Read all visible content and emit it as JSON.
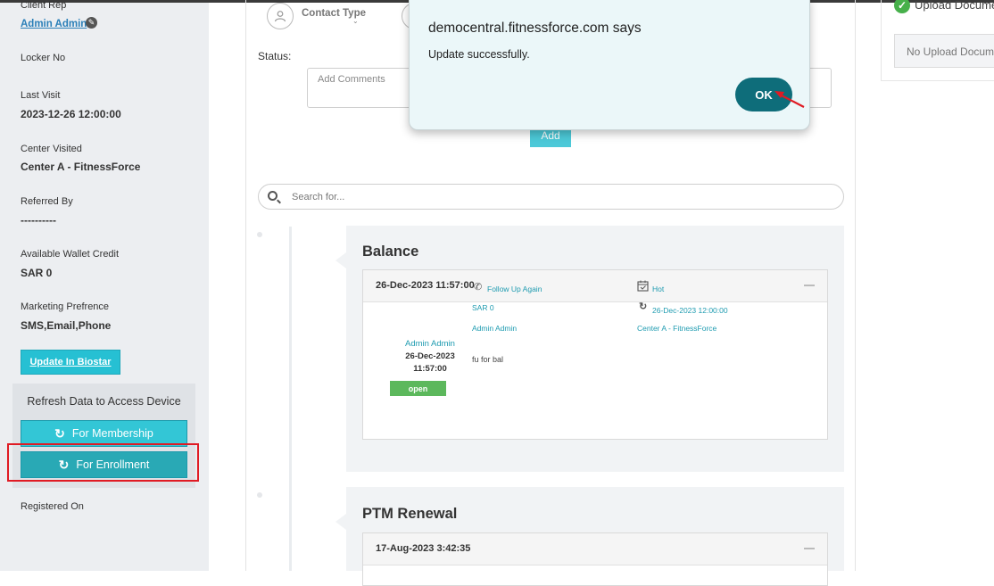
{
  "sidebar": {
    "client_rep_label": "Client Rep",
    "client_rep_value": "Admin Admin",
    "locker_label": "Locker No",
    "last_visit_label": "Last Visit",
    "last_visit_value": "2023-12-26 12:00:00",
    "center_visited_label": "Center Visited",
    "center_visited_value": "Center A - FitnessForce",
    "referred_by_label": "Referred By",
    "referred_by_value": "----------",
    "wallet_label": "Available Wallet Credit",
    "wallet_value": "SAR 0",
    "marketing_label": "Marketing Prefrence",
    "marketing_value": "SMS,Email,Phone",
    "biostar_button": "Update In Biostar",
    "refresh_title": "Refresh Data to Access Device",
    "membership_button": "For Membership",
    "enrollment_button": "For Enrollment",
    "registered_on_label": "Registered On"
  },
  "form": {
    "contact_type_label": "Contact Type",
    "status_label": "Status:",
    "comments_placeholder": "Add Comments",
    "add_button": "Add",
    "search_placeholder": "Search for..."
  },
  "cards": [
    {
      "title": "Balance",
      "entry_date": "26-Dec-2023 11:57:00",
      "user": "Admin Admin",
      "user_date": "26-Dec-2023",
      "user_time": "11:57:00",
      "status_badge": "open",
      "follow_up": "Follow Up Again",
      "priority": "Hot",
      "amount": "SAR 0",
      "next_date": "26-Dec-2023 12:00:00",
      "assigned_to": "Admin Admin",
      "center": "Center A - FitnessForce",
      "comment": "fu for bal"
    },
    {
      "title": "PTM Renewal",
      "entry_date": "17-Aug-2023 3:42:35"
    }
  ],
  "right_panel": {
    "upload_label": "Upload Documents",
    "no_upload": "No Upload Documents"
  },
  "dialog": {
    "title": "democentral.fitnessforce.com says",
    "message": "Update successfully.",
    "ok_button": "OK"
  },
  "colors": {
    "accent": "#29a9b5",
    "ok_button": "#0e6d7a",
    "highlight_border": "#e01b24",
    "open_badge": "#5cb85c"
  }
}
